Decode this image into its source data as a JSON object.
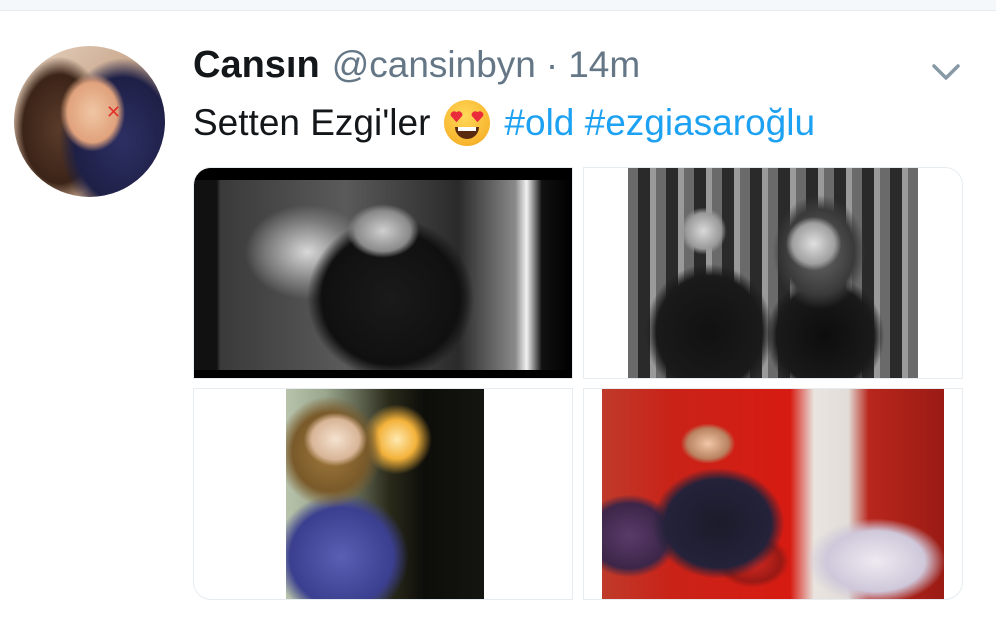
{
  "tweet": {
    "display_name": "Cansın",
    "handle": "@cansinbyn",
    "separator": "·",
    "time": "14m",
    "text": "Setten Ezgi'ler",
    "emoji": "smiling-face-with-heart-eyes",
    "hashtags": [
      "#old",
      "#ezgiasaroğlu"
    ]
  },
  "media": {
    "count": 4,
    "items": [
      {
        "kind": "photo",
        "style": "black-and-white"
      },
      {
        "kind": "photo",
        "style": "black-and-white"
      },
      {
        "kind": "photo",
        "style": "color"
      },
      {
        "kind": "photo",
        "style": "color"
      }
    ]
  },
  "icons": {
    "menu": "chevron-down-icon"
  },
  "colors": {
    "hashtag": "#1da1f2",
    "secondary_text": "#657786",
    "primary_text": "#14171a",
    "divider": "#e6ecf0"
  }
}
